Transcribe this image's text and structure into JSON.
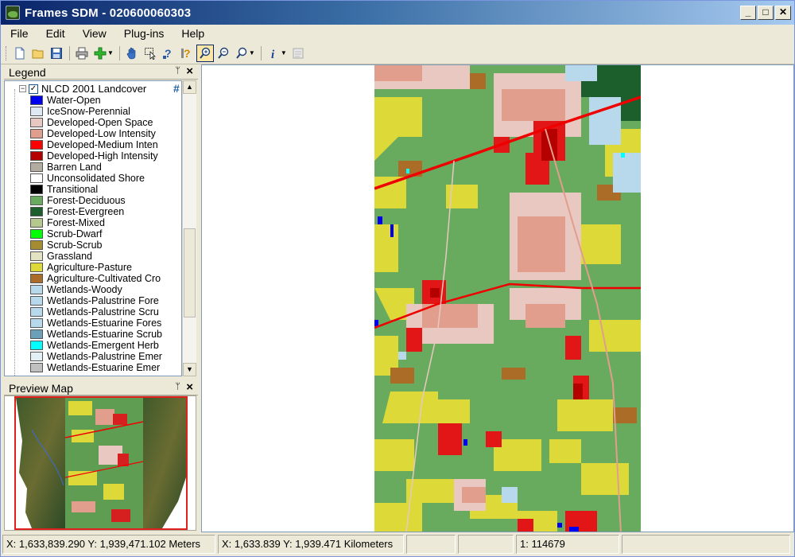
{
  "title": "Frames SDM  - 020600060303",
  "window_buttons": {
    "minimize": "_",
    "maximize": "□",
    "close": "✕"
  },
  "menu": [
    "File",
    "Edit",
    "View",
    "Plug-ins",
    "Help"
  ],
  "toolbar": {
    "buttons": [
      "new-icon",
      "open-icon",
      "save-icon",
      "print-icon",
      "add-layer-icon",
      "pan-icon",
      "select-icon",
      "identify-icon",
      "query-icon",
      "zoom-in-icon",
      "zoom-out-icon",
      "zoom-extents-icon",
      "info-icon",
      "layer-properties-icon"
    ]
  },
  "legend": {
    "header": "Legend",
    "pin": "ᛘ",
    "close": "×",
    "layer_name": "NLCD 2001 Landcover",
    "classes": [
      {
        "label": "Water-Open",
        "color": "#0000f0"
      },
      {
        "label": "IceSnow-Perennial",
        "color": "#dfe9f6"
      },
      {
        "label": "Developed-Open Space",
        "color": "#e8c8c0"
      },
      {
        "label": "Developed-Low Intensity",
        "color": "#e29e8c"
      },
      {
        "label": "Developed-Medium Inten",
        "color": "#ff0000"
      },
      {
        "label": "Developed-High Intensity",
        "color": "#b50000"
      },
      {
        "label": "Barren Land",
        "color": "#b3aca0"
      },
      {
        "label": "Unconsolidated Shore",
        "color": "#ffffff"
      },
      {
        "label": "Transitional",
        "color": "#000000"
      },
      {
        "label": "Forest-Deciduous",
        "color": "#68ab5f"
      },
      {
        "label": "Forest-Evergreen",
        "color": "#1c5f2c"
      },
      {
        "label": "Forest-Mixed",
        "color": "#b5c98e"
      },
      {
        "label": "Scrub-Dwarf",
        "color": "#00ff00"
      },
      {
        "label": "Scrub-Scrub",
        "color": "#a68c30"
      },
      {
        "label": "Grassland",
        "color": "#e3e3c2"
      },
      {
        "label": "Agriculture-Pasture",
        "color": "#dcd939"
      },
      {
        "label": "Agriculture-Cultivated Cro",
        "color": "#ab6c28"
      },
      {
        "label": "Wetlands-Woody",
        "color": "#b8d9eb"
      },
      {
        "label": "Wetlands-Palustrine Fore",
        "color": "#b8d9eb"
      },
      {
        "label": "Wetlands-Palustrine Scru",
        "color": "#b8d9eb"
      },
      {
        "label": "Wetlands-Estuarine Fores",
        "color": "#b8d9eb"
      },
      {
        "label": "Wetlands-Estuarine Scrub",
        "color": "#6c9fb8"
      },
      {
        "label": "Wetlands-Emergent Herb",
        "color": "#00ffff"
      },
      {
        "label": "Wetlands-Palustrine Emer",
        "color": "#e3eef5"
      },
      {
        "label": "Wetlands-Estuarine Emer",
        "color": "#c0c0c0"
      }
    ]
  },
  "preview": {
    "header": "Preview Map",
    "pin": "ᛘ",
    "close": "×"
  },
  "status": {
    "meters": "X: 1,633,839.290 Y: 1,939,471.102 Meters",
    "kilometers": "X: 1,633.839 Y: 1,939.471 Kilometers",
    "empty1": "",
    "empty2": "",
    "scale": "1: 114679",
    "empty3": ""
  }
}
